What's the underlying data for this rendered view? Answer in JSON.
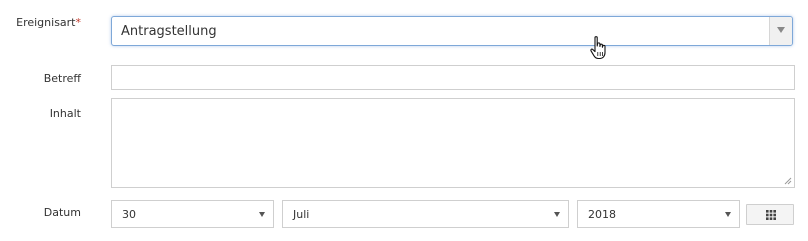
{
  "form": {
    "event_type": {
      "label": "Ereignisart",
      "required_marker": "*",
      "value": "Antragstellung"
    },
    "subject": {
      "label": "Betreff",
      "value": ""
    },
    "content": {
      "label": "Inhalt",
      "value": ""
    },
    "date": {
      "label": "Datum",
      "day": "30",
      "month": "Juli",
      "year": "2018"
    }
  },
  "icons": {
    "select_arrow": "chevron-down-icon",
    "calendar": "calendar-grid-icon",
    "cursor": "hand-pointer-icon",
    "resize": "resize-grip-icon"
  },
  "colors": {
    "focus_border": "#7ea8d8",
    "input_border": "#cfcfcf",
    "required": "#c0392b",
    "text": "#333333"
  }
}
